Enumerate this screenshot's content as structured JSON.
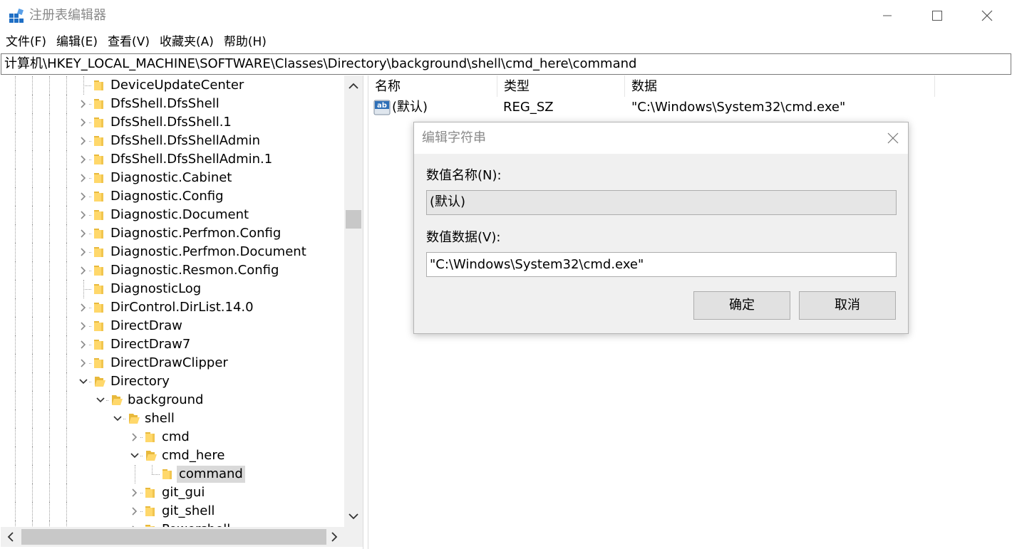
{
  "window": {
    "title": "注册表编辑器",
    "icon": "registry-editor-icon",
    "controls": [
      "minimize-icon",
      "maximize-icon",
      "close-icon"
    ]
  },
  "menu": [
    {
      "label": "文件(F)"
    },
    {
      "label": "编辑(E)"
    },
    {
      "label": "查看(V)"
    },
    {
      "label": "收藏夹(A)"
    },
    {
      "label": "帮助(H)"
    }
  ],
  "address": {
    "path": "计算机\\HKEY_LOCAL_MACHINE\\SOFTWARE\\Classes\\Directory\\background\\shell\\cmd_here\\command"
  },
  "tree": {
    "nodes": [
      {
        "label": "DeviceUpdateCenter",
        "depth": 0,
        "expander": "none",
        "selected": false
      },
      {
        "label": "DfsShell.DfsShell",
        "depth": 0,
        "expander": "collapsed",
        "selected": false
      },
      {
        "label": "DfsShell.DfsShell.1",
        "depth": 0,
        "expander": "collapsed",
        "selected": false
      },
      {
        "label": "DfsShell.DfsShellAdmin",
        "depth": 0,
        "expander": "collapsed",
        "selected": false
      },
      {
        "label": "DfsShell.DfsShellAdmin.1",
        "depth": 0,
        "expander": "collapsed",
        "selected": false
      },
      {
        "label": "Diagnostic.Cabinet",
        "depth": 0,
        "expander": "collapsed",
        "selected": false
      },
      {
        "label": "Diagnostic.Config",
        "depth": 0,
        "expander": "collapsed",
        "selected": false
      },
      {
        "label": "Diagnostic.Document",
        "depth": 0,
        "expander": "collapsed",
        "selected": false
      },
      {
        "label": "Diagnostic.Perfmon.Config",
        "depth": 0,
        "expander": "collapsed",
        "selected": false
      },
      {
        "label": "Diagnostic.Perfmon.Document",
        "depth": 0,
        "expander": "collapsed",
        "selected": false
      },
      {
        "label": "Diagnostic.Resmon.Config",
        "depth": 0,
        "expander": "collapsed",
        "selected": false
      },
      {
        "label": "DiagnosticLog",
        "depth": 0,
        "expander": "none",
        "selected": false
      },
      {
        "label": "DirControl.DirList.14.0",
        "depth": 0,
        "expander": "collapsed",
        "selected": false
      },
      {
        "label": "DirectDraw",
        "depth": 0,
        "expander": "collapsed",
        "selected": false
      },
      {
        "label": "DirectDraw7",
        "depth": 0,
        "expander": "collapsed",
        "selected": false
      },
      {
        "label": "DirectDrawClipper",
        "depth": 0,
        "expander": "collapsed",
        "selected": false
      },
      {
        "label": "Directory",
        "depth": 0,
        "expander": "expanded",
        "selected": false
      },
      {
        "label": "background",
        "depth": 1,
        "expander": "expanded",
        "selected": false
      },
      {
        "label": "shell",
        "depth": 2,
        "expander": "expanded",
        "selected": false
      },
      {
        "label": "cmd",
        "depth": 3,
        "expander": "collapsed",
        "selected": false
      },
      {
        "label": "cmd_here",
        "depth": 3,
        "expander": "expanded",
        "selected": false
      },
      {
        "label": "command",
        "depth": 4,
        "expander": "none",
        "selected": true
      },
      {
        "label": "git_gui",
        "depth": 3,
        "expander": "collapsed",
        "selected": false
      },
      {
        "label": "git_shell",
        "depth": 3,
        "expander": "collapsed",
        "selected": false
      },
      {
        "label": "Powershell",
        "depth": 3,
        "expander": "collapsed",
        "selected": false
      }
    ],
    "vscroll_position": 0.29
  },
  "list": {
    "columns": {
      "name": "名称",
      "type": "类型",
      "data": "数据"
    },
    "rows": [
      {
        "icon": "string-value-icon",
        "name": "(默认)",
        "type": "REG_SZ",
        "data": "\"C:\\Windows\\System32\\cmd.exe\""
      }
    ]
  },
  "dialog": {
    "title": "编辑字符串",
    "name_label": "数值名称(N):",
    "name_value": "(默认)",
    "data_label": "数值数据(V):",
    "data_value": "\"C:\\Windows\\System32\\cmd.exe\"",
    "ok_label": "确定",
    "cancel_label": "取消"
  },
  "colors": {
    "folder": "#ffd86b",
    "folder_dark": "#e8b93c",
    "selection": "#d9d9d9",
    "dialog_bg": "#f0f0f0",
    "icon_blue": "#1f6fc5"
  }
}
